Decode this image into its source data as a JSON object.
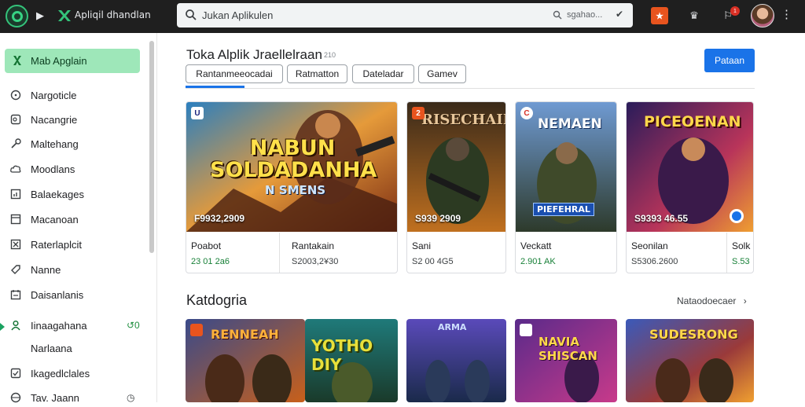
{
  "topbar": {
    "brand": "Apliqil dhandlan",
    "search_placeholder": "Jukan Aplikulen",
    "search_hint": "sgahao...",
    "notification_count": "1"
  },
  "sidebar": {
    "active": {
      "label": "Mab Apglain",
      "icon": "store-icon"
    },
    "items": [
      {
        "label": "Nargoticle",
        "icon": "circle-icon"
      },
      {
        "label": "Nacangrie",
        "icon": "tag-icon"
      },
      {
        "label": "Maltehang",
        "icon": "key-icon"
      },
      {
        "label": "Moodlans",
        "icon": "cloud-icon"
      },
      {
        "label": "Balaekages",
        "icon": "chart-icon"
      },
      {
        "label": "Macanoan",
        "icon": "window-icon"
      },
      {
        "label": "Raterlaplcit",
        "icon": "box-icon"
      },
      {
        "label": "Nanne",
        "icon": "ticket-icon"
      },
      {
        "label": "Daisanlanis",
        "icon": "calendar-icon"
      },
      {
        "label": "Iinaagahana",
        "icon": "user-icon",
        "trail": "↺0"
      },
      {
        "label": "Narlaana",
        "icon": ""
      },
      {
        "label": "Ikagedlclales",
        "icon": "checkbox-icon"
      },
      {
        "label": "Tav. Jaann",
        "icon": "globe-icon",
        "trail": "◷"
      }
    ]
  },
  "main": {
    "title": "Toka Alplik Jraellelraan",
    "title_sup": "210",
    "primary_button": "Pataan",
    "chips": [
      "Rantanmeeocadai",
      "Ratmatton",
      "Dateladar",
      "Gamev"
    ],
    "cards": [
      {
        "art_title": "NABUN SOLDADANHA",
        "art_sub": "N SMENS",
        "overlay_price": "F9932,2909",
        "badge": "U",
        "left_name": "Poabot",
        "left_price": "23 01 2a6",
        "right_name": "Rantakain",
        "right_price": "S2003,2¥30"
      },
      {
        "art_title": "RISECHAIN",
        "overlay_price": "S939 2909",
        "badge": "2",
        "name": "Sani",
        "price": "S2 00 4G5"
      },
      {
        "art_title": "NEMAEN",
        "art_sub": "PIEFEHRAL",
        "badge": "C",
        "name": "Veckatt",
        "price": "2.901 AK"
      },
      {
        "art_title": "PICEOENAN",
        "overlay_price": "S9393 46.55",
        "name": "Seonilan",
        "price": "S5306.2600",
        "extra_name": "Solk",
        "extra_price": "S.53"
      }
    ],
    "section_title": "Katdogria",
    "section_link": "Nataodoecaer",
    "categories": [
      {
        "title": "RENNEAH"
      },
      {
        "title": "YOTHO DIY"
      },
      {
        "title": "ARMA"
      },
      {
        "title": "NAVIA SHISCAN"
      },
      {
        "title": "SUDESRONG"
      }
    ]
  }
}
